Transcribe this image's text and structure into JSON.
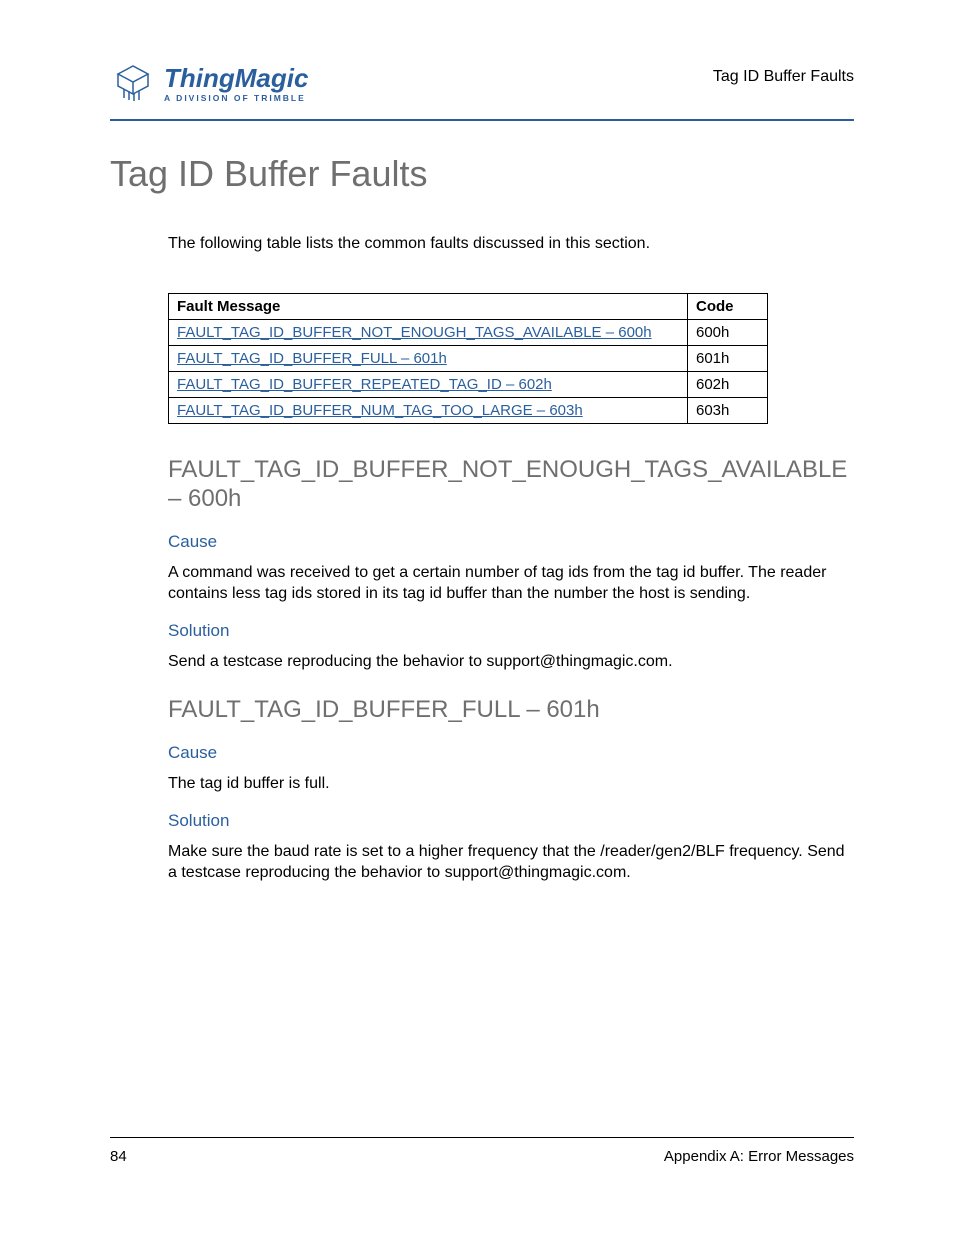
{
  "header": {
    "logo_main": "ThingMagic",
    "logo_sub": "A DIVISION OF TRIMBLE",
    "right": "Tag ID Buffer Faults"
  },
  "title": "Tag ID Buffer Faults",
  "intro": "The following table lists the common faults discussed in this section.",
  "table": {
    "headers": {
      "msg": "Fault Message",
      "code": "Code"
    },
    "rows": [
      {
        "msg": "FAULT_TAG_ID_BUFFER_NOT_ENOUGH_TAGS_AVAILABLE – 600h",
        "code": "600h"
      },
      {
        "msg": "FAULT_TAG_ID_BUFFER_FULL – 601h",
        "code": "601h"
      },
      {
        "msg": "FAULT_TAG_ID_BUFFER_REPEATED_TAG_ID – 602h",
        "code": "602h"
      },
      {
        "msg": "FAULT_TAG_ID_BUFFER_NUM_TAG_TOO_LARGE – 603h",
        "code": "603h"
      }
    ]
  },
  "sections": [
    {
      "heading": "FAULT_TAG_ID_BUFFER_NOT_ENOUGH_TAGS_AVAILABLE – 600h",
      "cause_label": "Cause",
      "cause_text": "A command was received to get a certain number of tag ids from the tag id buffer. The reader contains less tag ids stored in its tag id buffer than the number the host is sending.",
      "solution_label": "Solution",
      "solution_text": "Send a testcase reproducing the behavior to support@thingmagic.com."
    },
    {
      "heading": "FAULT_TAG_ID_BUFFER_FULL – 601h",
      "cause_label": "Cause",
      "cause_text": "The tag id buffer is full.",
      "solution_label": "Solution",
      "solution_text": "Make sure the baud rate is set to a higher frequency that the /reader/gen2/BLF frequency. Send a testcase reproducing the behavior to support@thingmagic.com."
    }
  ],
  "footer": {
    "page": "84",
    "appendix": "Appendix A: Error Messages"
  }
}
